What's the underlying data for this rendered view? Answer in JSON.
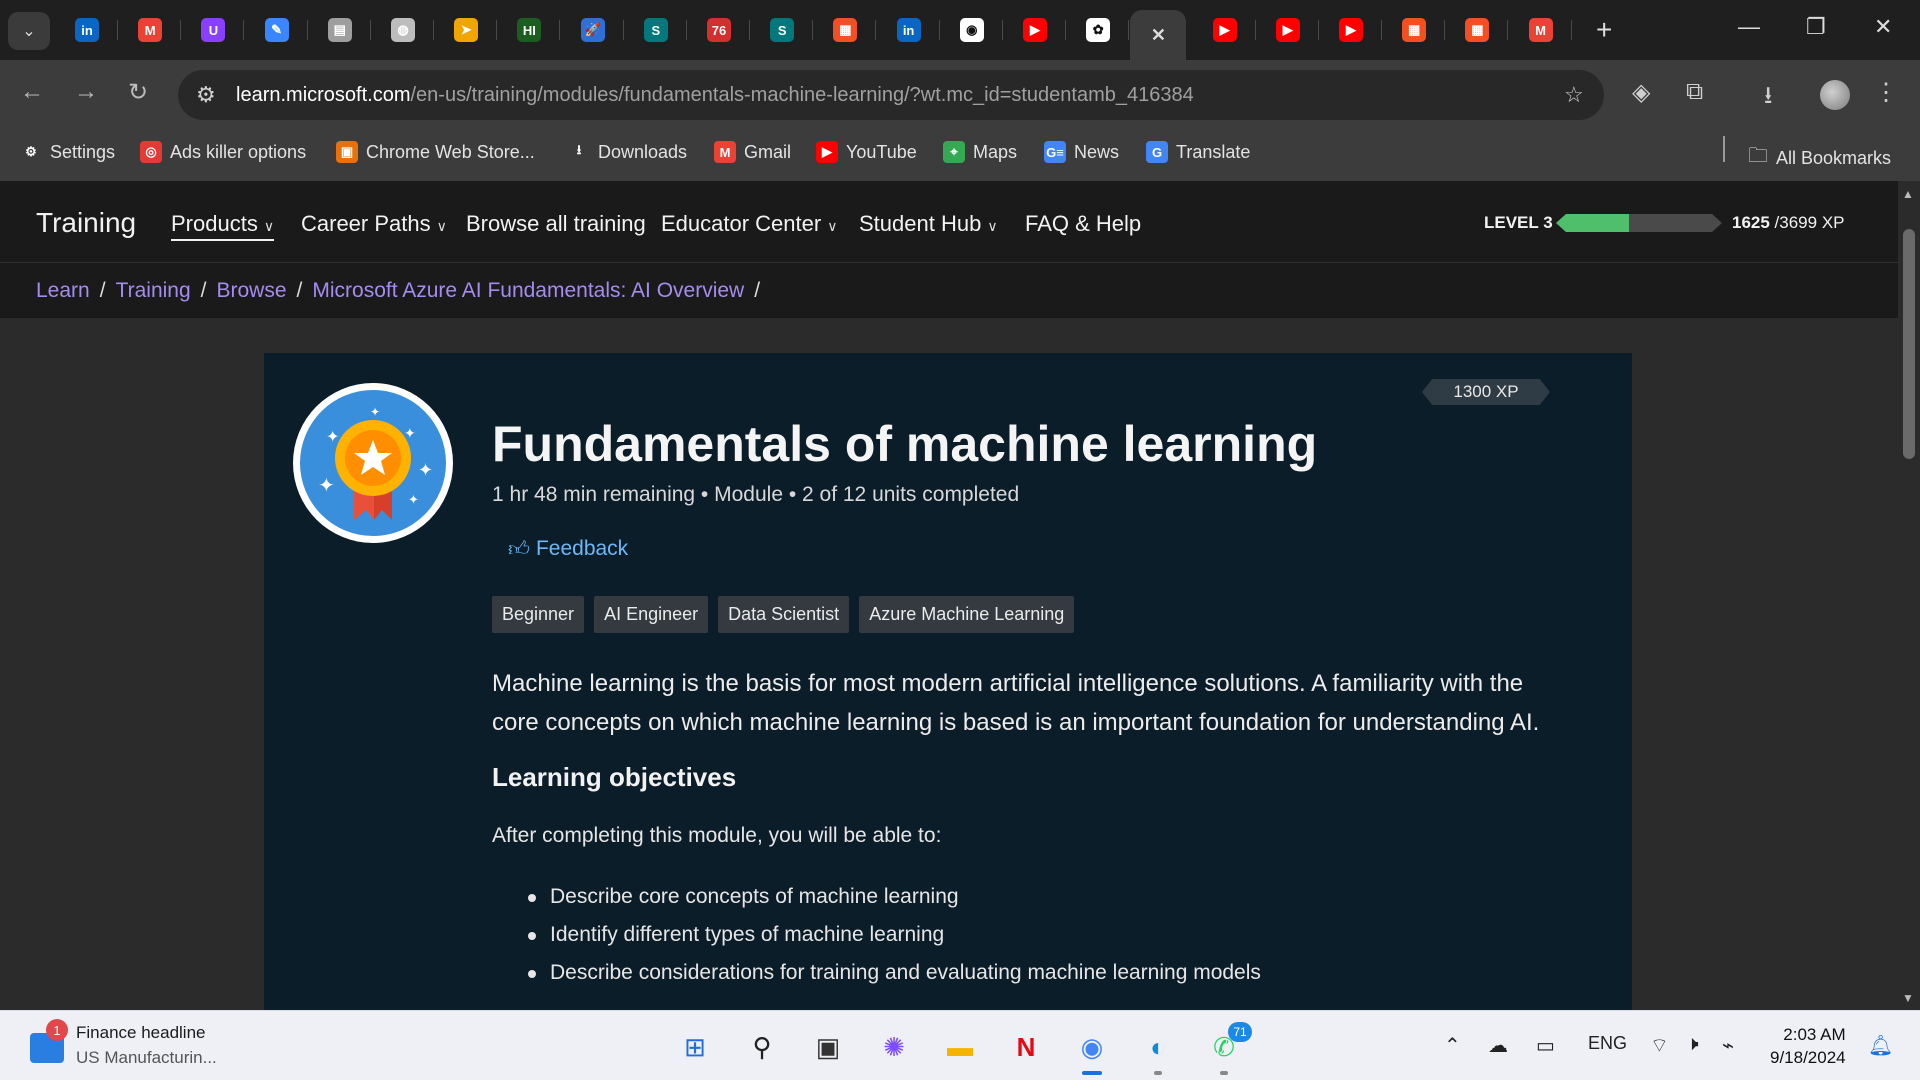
{
  "browser": {
    "tabs": [
      {
        "icon": "linkedin-icon",
        "glyph": "in",
        "color": "#0a66c2"
      },
      {
        "icon": "gmail-icon",
        "glyph": "M",
        "color": "#ea4335"
      },
      {
        "icon": "u-app-icon",
        "glyph": "U",
        "color": "#8a3ffc"
      },
      {
        "icon": "copilot-doc-icon",
        "glyph": "✎",
        "color": "#3a86ff"
      },
      {
        "icon": "document-icon",
        "glyph": "▤",
        "color": "#9e9e9e"
      },
      {
        "icon": "globe-icon",
        "glyph": "◍",
        "color": "#bdbdbd"
      },
      {
        "icon": "arrow-app-icon",
        "glyph": "➤",
        "color": "#f0a500"
      },
      {
        "icon": "hi-app-icon",
        "glyph": "HI",
        "color": "#1b5e20"
      },
      {
        "icon": "rocket-icon",
        "glyph": "🚀",
        "color": "#2f6fd6"
      },
      {
        "icon": "sharepoint-icon",
        "glyph": "S",
        "color": "#03787c"
      },
      {
        "icon": "counter-76-icon",
        "glyph": "76",
        "color": "#d32f2f"
      },
      {
        "icon": "sharepoint-icon-2",
        "glyph": "S",
        "color": "#03787c"
      },
      {
        "icon": "microsoft-icon",
        "glyph": "▦",
        "color": "#f25022"
      },
      {
        "icon": "linkedin-icon-2",
        "glyph": "in",
        "color": "#0a66c2"
      },
      {
        "icon": "github-icon",
        "glyph": "◉",
        "color": "#ffffff"
      },
      {
        "icon": "youtube-icon",
        "glyph": "▶",
        "color": "#ff0000"
      },
      {
        "icon": "openai-icon",
        "glyph": "✿",
        "color": "#ffffff"
      },
      {
        "icon": "close-tab-icon",
        "glyph": "✕",
        "color": "#3c3c3c"
      },
      {
        "icon": "youtube-icon-2",
        "glyph": "▶",
        "color": "#ff0000"
      },
      {
        "icon": "youtube-icon-3",
        "glyph": "▶",
        "color": "#ff0000"
      },
      {
        "icon": "youtube-icon-4",
        "glyph": "▶",
        "color": "#ff0000"
      },
      {
        "icon": "microsoft-icon-2",
        "glyph": "▦",
        "color": "#f25022"
      },
      {
        "icon": "microsoft-icon-3",
        "glyph": "▦",
        "color": "#f25022"
      },
      {
        "icon": "gmail-icon-2",
        "glyph": "M",
        "color": "#ea4335"
      }
    ],
    "url_host": "learn.microsoft.com",
    "url_path": "/en-us/training/modules/fundamentals-machine-learning/?wt.mc_id=studentamb_416384",
    "bookmarks": [
      {
        "label": "Settings",
        "icon": "gear-icon",
        "glyph": "⚙",
        "color": "#3c3c3c"
      },
      {
        "label": "Ads killer options",
        "icon": "target-icon",
        "glyph": "◎",
        "color": "#e53935"
      },
      {
        "label": "Chrome Web Store...",
        "icon": "web-store-icon",
        "glyph": "▣",
        "color": "#e8710a"
      },
      {
        "label": "Downloads",
        "icon": "download-icon",
        "glyph": "⭳",
        "color": "#3c3c3c"
      },
      {
        "label": "Gmail",
        "icon": "gmail-icon",
        "glyph": "M",
        "color": "#ea4335"
      },
      {
        "label": "YouTube",
        "icon": "youtube-icon",
        "glyph": "▶",
        "color": "#ff0000"
      },
      {
        "label": "Maps",
        "icon": "maps-icon",
        "glyph": "⌖",
        "color": "#34a853"
      },
      {
        "label": "News",
        "icon": "news-icon",
        "glyph": "G≡",
        "color": "#4285f4"
      },
      {
        "label": "Translate",
        "icon": "translate-icon",
        "glyph": "G",
        "color": "#4285f4"
      }
    ],
    "all_bookmarks": "All Bookmarks"
  },
  "site": {
    "brand": "Training",
    "nav": [
      {
        "label": "Products",
        "chevron": true
      },
      {
        "label": "Career Paths",
        "chevron": true
      },
      {
        "label": "Browse all training",
        "chevron": false
      },
      {
        "label": "Educator Center",
        "chevron": true
      },
      {
        "label": "Student Hub",
        "chevron": true
      },
      {
        "label": "FAQ & Help",
        "chevron": false
      }
    ],
    "level": "LEVEL 3",
    "xp_current": "1625",
    "xp_total": " /3699 XP",
    "xp_fraction": 0.44,
    "breadcrumb": [
      "Learn",
      "Training",
      "Browse",
      "Microsoft Azure AI Fundamentals: AI Overview"
    ]
  },
  "module": {
    "xp_badge": "1300 XP",
    "title": "Fundamentals of machine learning",
    "meta": "1 hr 48 min remaining • Module • 2 of 12 units completed",
    "feedback": "Feedback",
    "tags": [
      "Beginner",
      "AI Engineer",
      "Data Scientist",
      "Azure Machine Learning"
    ],
    "description": "Machine learning is the basis for most modern artificial intelligence solutions. A familiarity with the core concepts on which machine learning is based is an important foundation for understanding AI.",
    "objectives_heading": "Learning objectives",
    "objectives_intro": "After completing this module, you will be able to:",
    "objectives": [
      "Describe core concepts of machine learning",
      "Identify different types of machine learning",
      "Describe considerations for training and evaluating machine learning models"
    ]
  },
  "taskbar": {
    "news_title": "Finance headline",
    "news_sub": "US Manufacturin...",
    "news_badge": "1",
    "whatsapp_badge": "71",
    "language": "ENG",
    "time": "2:03 AM",
    "date": "9/18/2024"
  }
}
